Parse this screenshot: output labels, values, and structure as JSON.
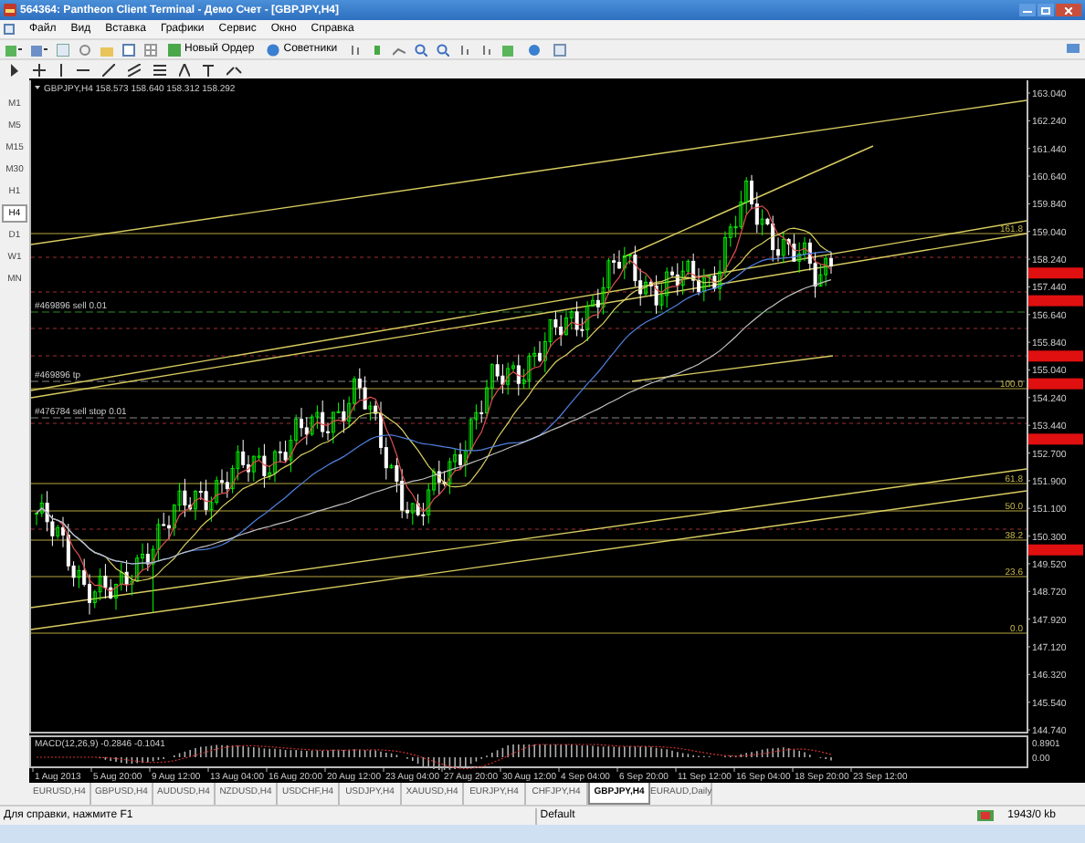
{
  "window": {
    "title": "564364: Pantheon Client Terminal - Демо Счет - [GBPJPY,H4]"
  },
  "menu": [
    "Файл",
    "Вид",
    "Вставка",
    "Графики",
    "Сервис",
    "Окно",
    "Справка"
  ],
  "toolbar": {
    "buttons": [
      {
        "label": "Новый Ордер"
      },
      {
        "label": "Советники"
      }
    ]
  },
  "timeframes": [
    {
      "label": "M1",
      "selected": false
    },
    {
      "label": "M5",
      "selected": false
    },
    {
      "label": "M15",
      "selected": false
    },
    {
      "label": "M30",
      "selected": false
    },
    {
      "label": "H1",
      "selected": false
    },
    {
      "label": "H4",
      "selected": true
    },
    {
      "label": "D1",
      "selected": false
    },
    {
      "label": "W1",
      "selected": false
    },
    {
      "label": "MN",
      "selected": false
    }
  ],
  "chart": {
    "header": "GBPJPY,H4  158.573 158.640 158.312 158.292",
    "orders": [
      "#469896 sell 0.01",
      "#469896 tp",
      "#476784 sell stop 0.01"
    ],
    "fib_levels": [
      "161.8",
      "100.0",
      "61.8",
      "50.0",
      "38.2",
      "23.6",
      "0.0"
    ],
    "price_axis": [
      "163.040",
      "162.240",
      "161.440",
      "160.640",
      "159.840",
      "159.040",
      "158.240",
      "157.440",
      "156.640",
      "155.840",
      "155.040",
      "154.240",
      "153.440",
      "152.700",
      "151.900",
      "151.100",
      "150.300",
      "149.520",
      "148.720",
      "147.920",
      "147.120",
      "146.320",
      "145.540",
      "144.740"
    ],
    "macd": {
      "label": "MACD(12,26,9) -0.2846 -0.1041",
      "axis": [
        "0.8901",
        "0.00"
      ]
    },
    "time_axis": [
      "1 Aug 2013",
      "5 Aug 20:00",
      "9 Aug 12:00",
      "13 Aug 04:00",
      "16 Aug 20:00",
      "20 Aug 12:00",
      "23 Aug 04:00",
      "27 Aug 20:00",
      "30 Aug 12:00",
      "4 Sep 04:00",
      "6 Sep 20:00",
      "11 Sep 12:00",
      "16 Sep 04:00",
      "18 Sep 20:00",
      "23 Sep 12:00"
    ]
  },
  "tabs": [
    {
      "label": "EURUSD,H4",
      "selected": false
    },
    {
      "label": "GBPUSD,H4",
      "selected": false
    },
    {
      "label": "AUDUSD,H4",
      "selected": false
    },
    {
      "label": "NZDUSD,H4",
      "selected": false
    },
    {
      "label": "USDCHF,H4",
      "selected": false
    },
    {
      "label": "USDJPY,H4",
      "selected": false
    },
    {
      "label": "XAUUSD,H4",
      "selected": false
    },
    {
      "label": "EURJPY,H4",
      "selected": false
    },
    {
      "label": "CHFJPY,H4",
      "selected": false
    },
    {
      "label": "GBPJPY,H4",
      "selected": true
    },
    {
      "label": "EURAUD,Daily",
      "selected": false
    }
  ],
  "status_bar": {
    "help": "Для справки, нажмите F1",
    "profile": "Default",
    "traffic": "1943/0 kb"
  }
}
